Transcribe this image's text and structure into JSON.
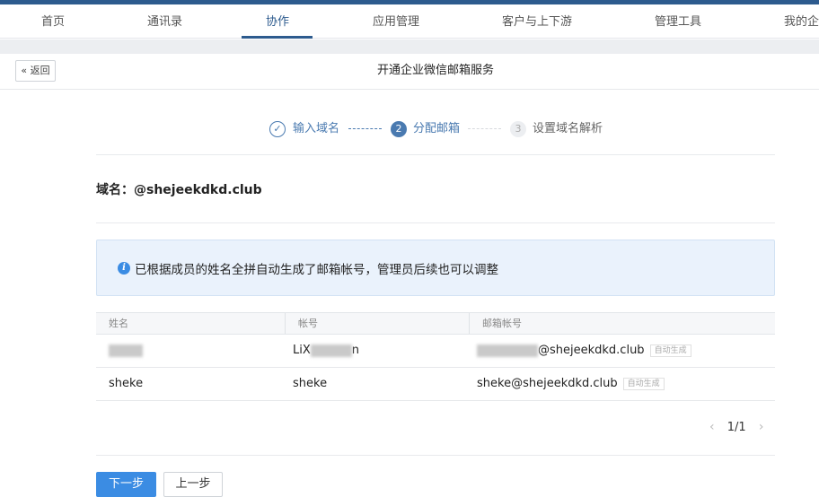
{
  "nav": {
    "items": [
      "首页",
      "通讯录",
      "协作",
      "应用管理",
      "客户与上下游",
      "管理工具",
      "我的企"
    ],
    "active_index": 2
  },
  "header": {
    "back_label": "« 返回",
    "title": "开通企业微信邮箱服务"
  },
  "steps": [
    {
      "label": "输入域名",
      "state": "done",
      "number": "✓"
    },
    {
      "label": "分配邮箱",
      "state": "active",
      "number": "2"
    },
    {
      "label": "设置域名解析",
      "state": "pending",
      "number": "3"
    }
  ],
  "domain": {
    "label": "域名：",
    "value": "@shejeekdkd.club"
  },
  "notice": {
    "icon": "info-icon",
    "text": "已根据成员的姓名全拼自动生成了邮箱帐号，管理员后续也可以调整"
  },
  "table": {
    "headers": [
      "姓名",
      "帐号",
      "邮箱帐号"
    ],
    "rows": [
      {
        "name": "",
        "account_prefix": "LiX",
        "account_suffix": "n",
        "email_suffix": "@shejeekdkd.club",
        "tag": "自动生成"
      },
      {
        "name": "sheke",
        "account_prefix": "sheke",
        "account_suffix": "",
        "email_suffix": "sheke@shejeekdkd.club",
        "tag": "自动生成"
      }
    ]
  },
  "pager": {
    "prev": "‹",
    "text": "1/1",
    "next": "›"
  },
  "actions": {
    "next_label": "下一步",
    "prev_label": "上一步"
  },
  "colors": {
    "brand": "#2d5b8e",
    "primary": "#3b8ce3",
    "notice_bg": "#eaf2fc"
  }
}
